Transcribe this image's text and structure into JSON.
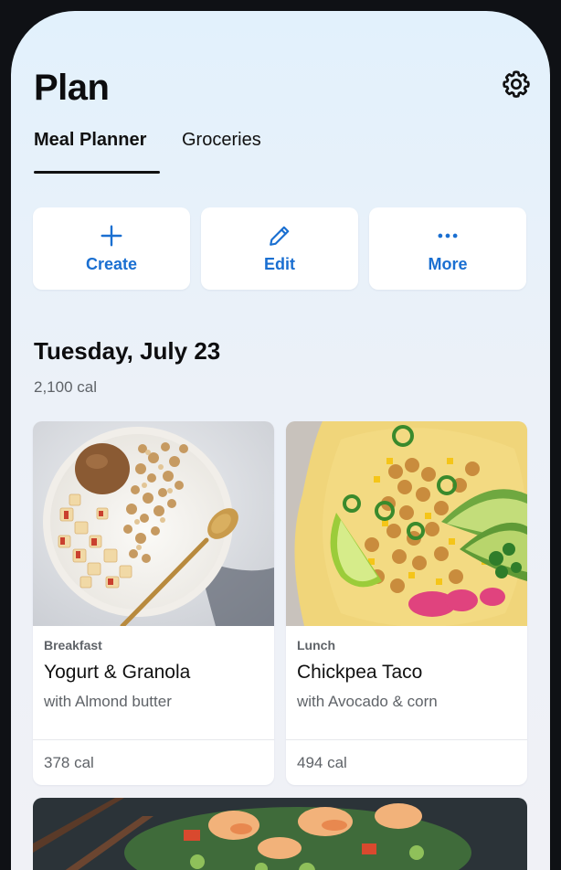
{
  "header": {
    "title": "Plan",
    "settings_icon": "gear-icon"
  },
  "tabs": [
    {
      "label": "Meal Planner",
      "active": true
    },
    {
      "label": "Groceries",
      "active": false
    }
  ],
  "actions": [
    {
      "label": "Create",
      "icon": "plus-icon"
    },
    {
      "label": "Edit",
      "icon": "pencil-icon"
    },
    {
      "label": "More",
      "icon": "more-horizontal-icon"
    }
  ],
  "accent_color": "#1a6fd1",
  "day": {
    "title": "Tuesday, July 23",
    "calories": "2,100 cal"
  },
  "meals": [
    {
      "meal": "Breakfast",
      "name": "Yogurt & Granola",
      "description": "with Almond butter",
      "calories": "378 cal"
    },
    {
      "meal": "Lunch",
      "name": "Chickpea Taco",
      "description": "with Avocado & corn",
      "calories": "494 cal"
    }
  ]
}
